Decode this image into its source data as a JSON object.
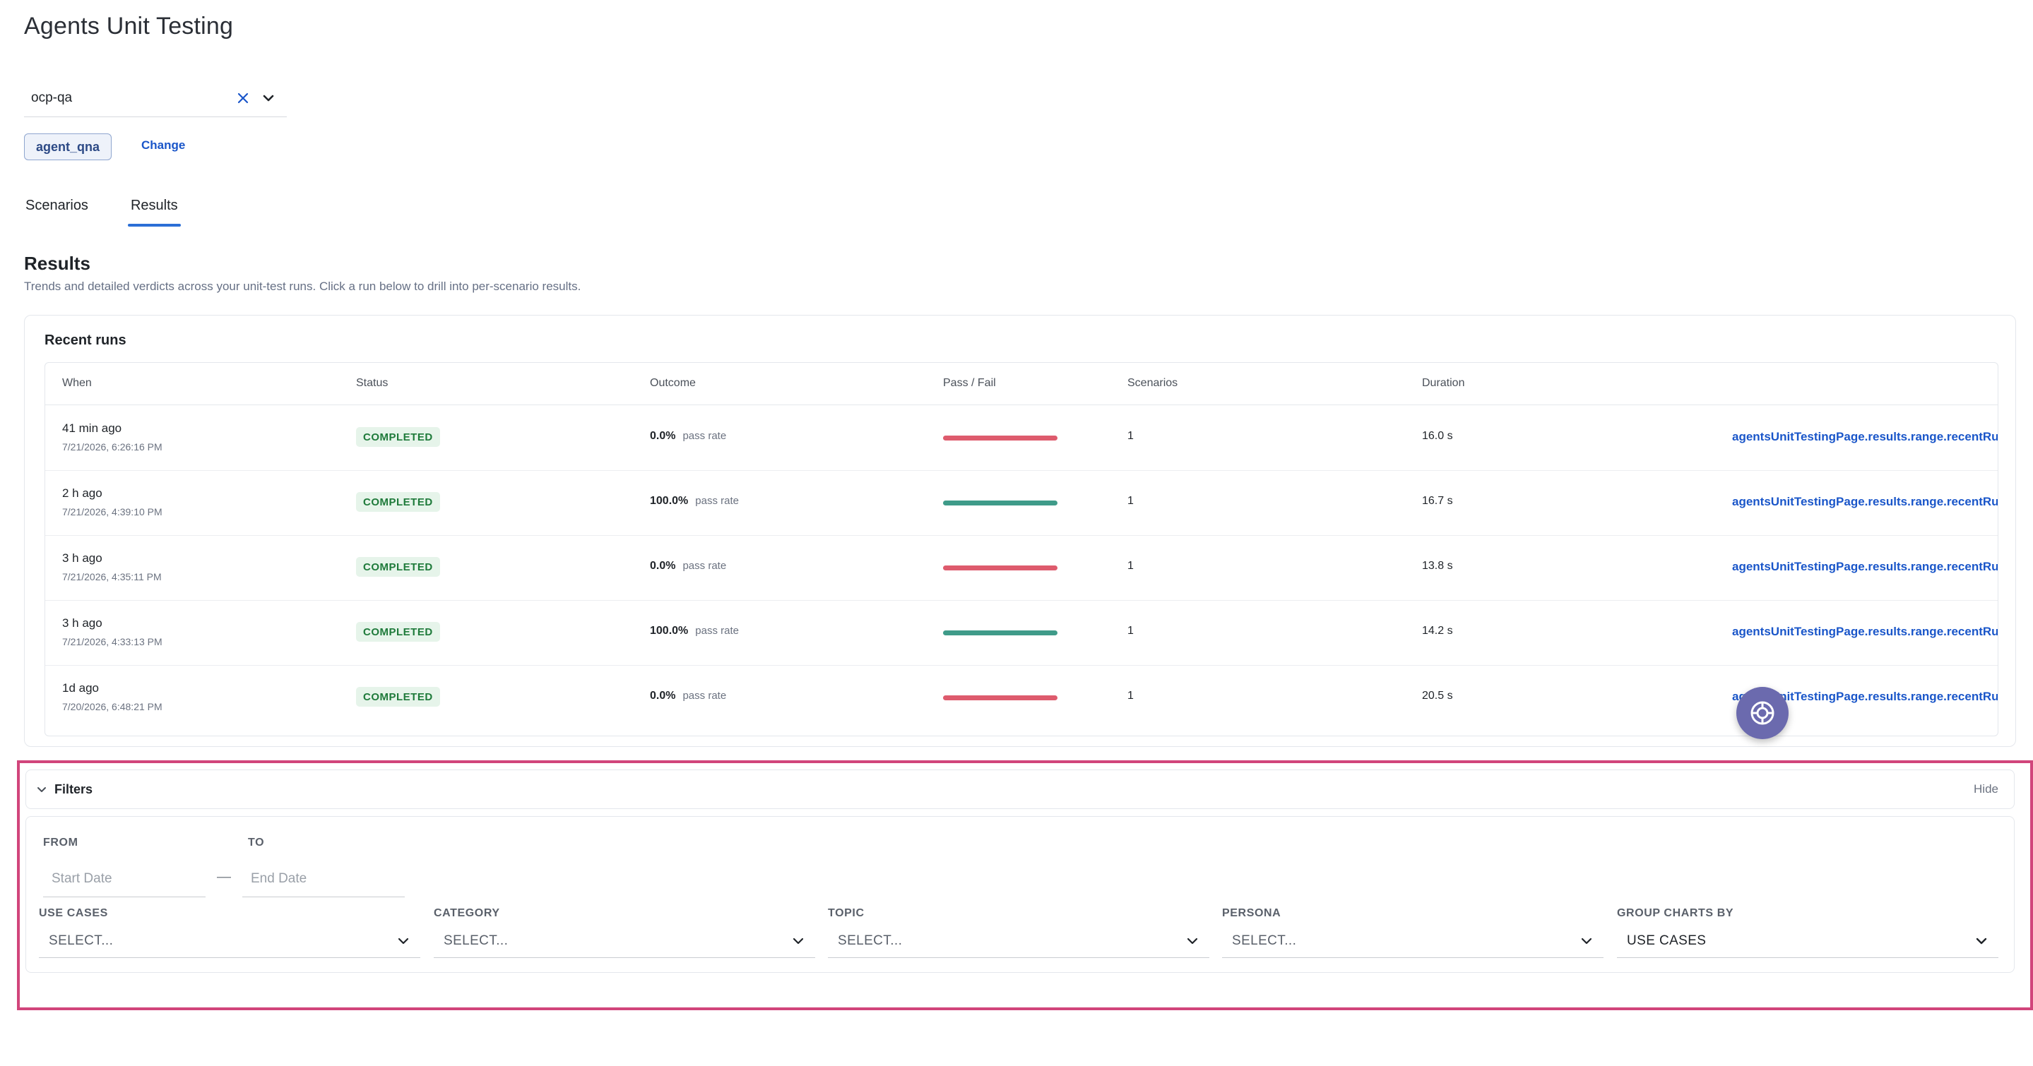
{
  "page": {
    "title": "Agents Unit Testing"
  },
  "project": {
    "value": "ocp-qa"
  },
  "agent": {
    "tag": "agent_qna",
    "change_label": "Change"
  },
  "tabs": [
    {
      "label": "Scenarios",
      "active": false
    },
    {
      "label": "Results",
      "active": true
    }
  ],
  "results": {
    "title": "Results",
    "description": "Trends and detailed verdicts across your unit-test runs. Click a run below to drill into per-scenario results."
  },
  "recent_runs": {
    "title": "Recent runs",
    "columns": [
      "When",
      "Status",
      "Outcome",
      "Pass / Fail",
      "Scenarios",
      "Duration"
    ],
    "rows": [
      {
        "when": "41 min ago",
        "timestamp": "7/21/2026, 6:26:16 PM",
        "status": "COMPLETED",
        "outcome": "0.0%",
        "outcome_label": "pass rate",
        "pass_rate": 0.0,
        "scenarios": "1",
        "duration": "16.0 s",
        "link": "agentsUnitTestingPage.results.range.recentRuns"
      },
      {
        "when": "2 h ago",
        "timestamp": "7/21/2026, 4:39:10 PM",
        "status": "COMPLETED",
        "outcome": "100.0%",
        "outcome_label": "pass rate",
        "pass_rate": 1.0,
        "scenarios": "1",
        "duration": "16.7 s",
        "link": "agentsUnitTestingPage.results.range.recentRuns"
      },
      {
        "when": "3 h ago",
        "timestamp": "7/21/2026, 4:35:11 PM",
        "status": "COMPLETED",
        "outcome": "0.0%",
        "outcome_label": "pass rate",
        "pass_rate": 0.0,
        "scenarios": "1",
        "duration": "13.8 s",
        "link": "agentsUnitTestingPage.results.range.recentRuns"
      },
      {
        "when": "3 h ago",
        "timestamp": "7/21/2026, 4:33:13 PM",
        "status": "COMPLETED",
        "outcome": "100.0%",
        "outcome_label": "pass rate",
        "pass_rate": 1.0,
        "scenarios": "1",
        "duration": "14.2 s",
        "link": "agentsUnitTestingPage.results.range.recentRuns"
      },
      {
        "when": "1d ago",
        "timestamp": "7/20/2026, 6:48:21 PM",
        "status": "COMPLETED",
        "outcome": "0.0%",
        "outcome_label": "pass rate",
        "pass_rate": 0.0,
        "scenarios": "1",
        "duration": "20.5 s",
        "link": "agentsUnitTestingPage.results.range.recentRuns"
      }
    ]
  },
  "filters": {
    "title": "Filters",
    "hide_label": "Hide",
    "from_label": "FROM",
    "to_label": "TO",
    "from_placeholder": "Start Date",
    "to_placeholder": "End Date",
    "date_separator": "—",
    "use_cases": {
      "label": "USE CASES",
      "value": "SELECT..."
    },
    "category": {
      "label": "CATEGORY",
      "value": "SELECT..."
    },
    "topic": {
      "label": "TOPIC",
      "value": "SELECT..."
    },
    "persona": {
      "label": "PERSONA",
      "value": "SELECT..."
    },
    "group_by": {
      "label": "GROUP CHARTS BY",
      "value": "USE CASES"
    }
  },
  "colors": {
    "accent": "#2b6fd6",
    "link": "#1a56c9",
    "fail_bar": "#de5b6d",
    "pass_bar": "#3f9b89",
    "status_completed_bg": "#e6f4ea",
    "status_completed_text": "#1e7a3a",
    "highlight_frame": "#d1457b"
  },
  "icons": {
    "clear": "close-icon",
    "dropdown": "chevron-down-icon",
    "filters_toggle": "chevron-down-icon",
    "help": "help-icon"
  }
}
